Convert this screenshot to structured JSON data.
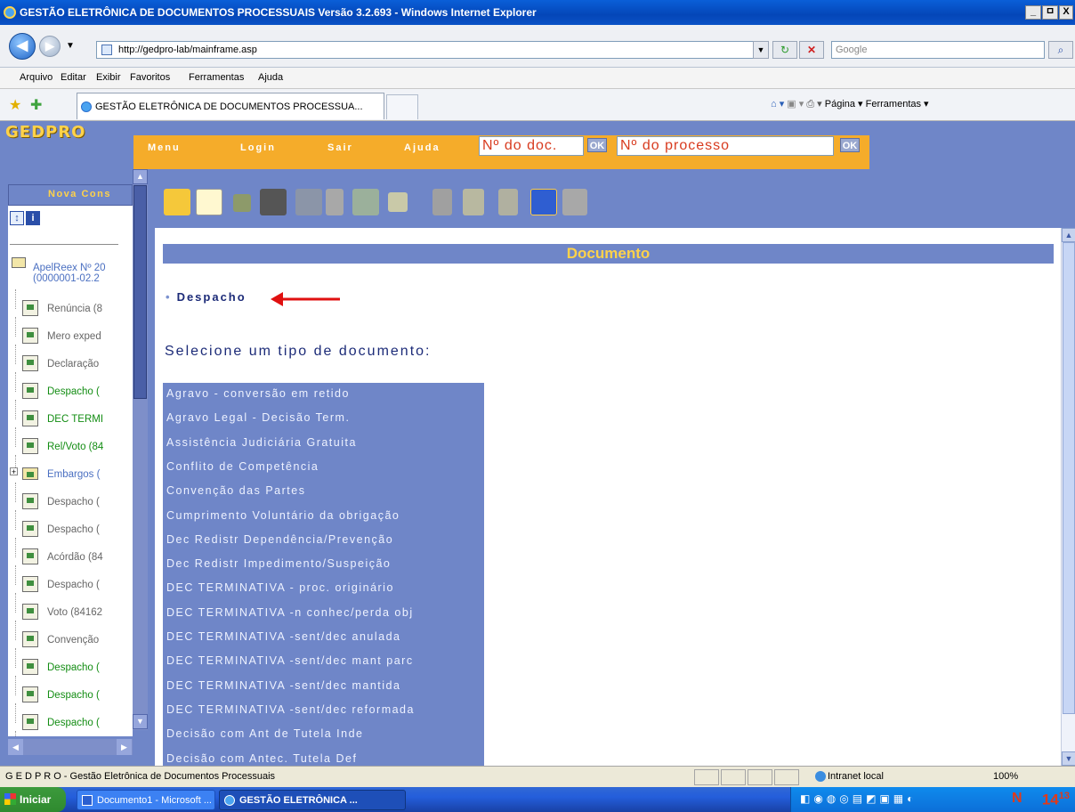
{
  "window": {
    "title": "GESTÃO ELETRÔNICA DE DOCUMENTOS PROCESSUAIS Versão 3.2.693 - Windows Internet Explorer",
    "min": "_",
    "max": "ㅁ",
    "close": "X"
  },
  "browser": {
    "url": "http://gedpro-lab/mainframe.asp",
    "search_placeholder": "Google",
    "menu": [
      "Arquivo",
      "Editar",
      "Exibir",
      "Favoritos",
      "Ferramentas",
      "Ajuda"
    ],
    "tab_title": "GESTÃO ELETRÔNICA DE DOCUMENTOS PROCESSUA...",
    "commands": "Página ▾   Ferramentas ▾"
  },
  "app": {
    "logo": "GEDPRO",
    "nav": [
      "Menu",
      "Login",
      "Sair",
      "Ajuda"
    ],
    "doc_input_placeholder": "Nº do doc.",
    "proc_input_placeholder": "Nº do processo",
    "ok": "OK"
  },
  "sidebar": {
    "button": "Nova Cons",
    "root": [
      "ApelReex Nº 20",
      "(0000001-02.2"
    ],
    "items": [
      {
        "label": "Renúncia (8",
        "color": "grey"
      },
      {
        "label": "Mero exped",
        "color": "grey"
      },
      {
        "label": "Declaração",
        "color": "grey"
      },
      {
        "label": "Despacho (",
        "color": "green"
      },
      {
        "label": "DEC TERMI",
        "color": "green"
      },
      {
        "label": "Rel/Voto (84",
        "color": "green"
      },
      {
        "label": "Embargos (",
        "color": "blue"
      },
      {
        "label": "Despacho (",
        "color": "grey"
      },
      {
        "label": "Despacho (",
        "color": "grey"
      },
      {
        "label": "Acórdão (84",
        "color": "grey"
      },
      {
        "label": "Despacho (",
        "color": "grey"
      },
      {
        "label": "Voto (84162",
        "color": "grey"
      },
      {
        "label": "Convenção",
        "color": "grey"
      },
      {
        "label": "Despacho (",
        "color": "green"
      },
      {
        "label": "Despacho (",
        "color": "green"
      },
      {
        "label": "Despacho (",
        "color": "green"
      },
      {
        "label": "Despacho (",
        "color": "green"
      }
    ]
  },
  "main": {
    "section_title": "Documento",
    "current_doc": "Despacho",
    "select_prompt": "Selecione um tipo de documento:",
    "document_types": [
      "Agravo - conversão em retido",
      "Agravo Legal - Decisão Term.",
      "Assistência Judiciária Gratuita",
      "Conflito de Competência",
      "Convenção das Partes",
      "Cumprimento Voluntário da obrigação",
      "Dec Redistr Dependência/Prevenção",
      "Dec Redistr Impedimento/Suspeição",
      "DEC TERMINATIVA - proc. originário",
      "DEC TERMINATIVA -n conhec/perda obj",
      "DEC TERMINATIVA -sent/dec anulada",
      "DEC TERMINATIVA -sent/dec mant parc",
      "DEC TERMINATIVA -sent/dec mantida",
      "DEC TERMINATIVA -sent/dec reformada",
      "Decisão com Ant de Tutela Inde",
      "Decisão com Antec. Tutela Def"
    ]
  },
  "statusbar": {
    "text": "G E D P R O - Gestão Eletrônica de Documentos Processuais",
    "zone": "Intranet local",
    "zoom": "100%"
  },
  "taskbar": {
    "start": "Iniciar",
    "tasks": [
      "Documento1 - Microsoft ...",
      "GESTÃO ELETRÔNICA ..."
    ],
    "clock_hour": "14",
    "clock_min": "13"
  },
  "colors": {
    "frame_blue": "#6f86c8",
    "orange": "#f5ac2a",
    "gold": "#ffd24a",
    "navy_text": "#1c2b78",
    "arrow_red": "#e01010"
  }
}
